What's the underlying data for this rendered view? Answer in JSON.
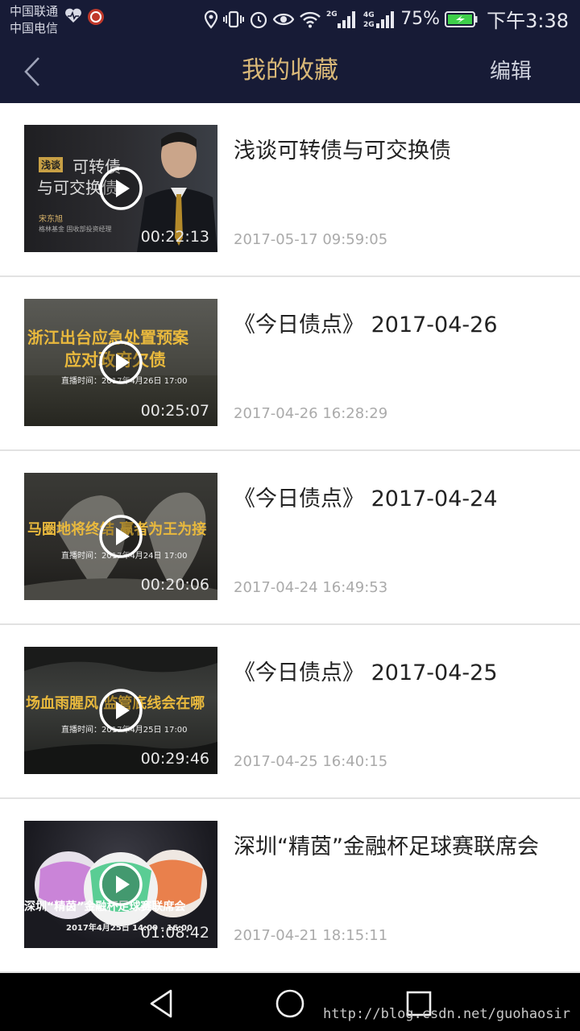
{
  "status_bar": {
    "carrier_1": "中国联通",
    "carrier_2": "中国电信",
    "network_1": "2G",
    "network_2a": "4G",
    "network_2b": "2G",
    "battery_percent": "75%",
    "time": "下午3:38"
  },
  "topbar": {
    "title": "我的收藏",
    "edit_label": "编辑"
  },
  "items": [
    {
      "title": "浅谈可转债与可交换债",
      "date": "2017-05-17 09:59:05",
      "duration": "00:22:13",
      "thumb_text_1": "浅谈",
      "thumb_text_2": "可转债",
      "thumb_text_3": "与可交换债",
      "thumb_text_4": "宋东旭",
      "thumb_text_5": "格林基金 固收部投资经理"
    },
    {
      "title": "《今日债点》 2017-04-26",
      "date": "2017-04-26 16:28:29",
      "duration": "00:25:07",
      "thumb_text_1": "浙江出台应急处置预案",
      "thumb_text_2": "应对政府欠债",
      "thumb_text_3": "直播时间：2017年4月26日 17:00"
    },
    {
      "title": "《今日债点》 2017-04-24",
      "date": "2017-04-24 16:49:53",
      "duration": "00:20:06",
      "thumb_text_1": "马圈地将终结 赢者为王为接",
      "thumb_text_2": "直播时间：2017年4月24日 17:00"
    },
    {
      "title": "《今日债点》 2017-04-25",
      "date": "2017-04-25 16:40:15",
      "duration": "00:29:46",
      "thumb_text_1": "场血雨腥风 监管底线会在哪",
      "thumb_text_2": "直播时间：2017年4月25日 17:00"
    },
    {
      "title": "深圳“精茵”金融杯足球赛联席会",
      "date": "2017-04-21 18:15:11",
      "duration": "01:08:42",
      "thumb_text_1": "深圳“精茵”金融杯足球赛联席会",
      "thumb_text_2": "2017年4月25日 14:00 - 16:00"
    }
  ],
  "watermark": "http://blog.csdn.net/guohaosir",
  "colors": {
    "header_bg": "#171b36",
    "title_gold": "#d9b878",
    "date_gray": "#aaaaaa",
    "divider": "#e2e2e2"
  },
  "icons": [
    "back-arrow-icon",
    "play-icon",
    "nav-back-icon",
    "nav-home-icon",
    "nav-recents-icon"
  ]
}
